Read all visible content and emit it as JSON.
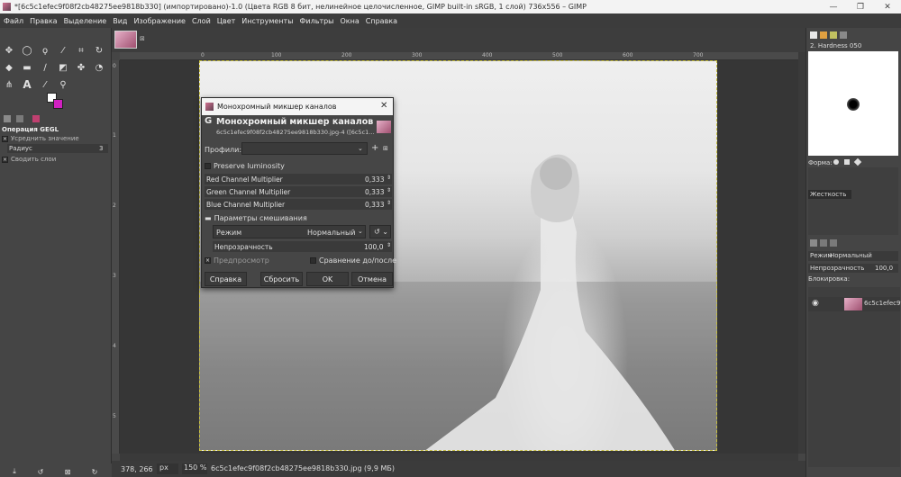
{
  "window": {
    "title": "*[6c5c1efec9f08f2cb48275ee9818b330] (импортировано)-1.0 (Цвета RGB 8 бит, нелинейное целочисленное, GIMP built-in sRGB, 1 слой) 736x556 – GIMP",
    "minimize": "—",
    "maximize": "❐",
    "close": "✕"
  },
  "menu": [
    "Файл",
    "Правка",
    "Выделение",
    "Вид",
    "Изображение",
    "Слой",
    "Цвет",
    "Инструменты",
    "Фильтры",
    "Окна",
    "Справка"
  ],
  "tool_options": {
    "title": "Операция GEGL",
    "sample_average": "Усреднить значение",
    "radius_label": "Радиус",
    "radius_value": "3",
    "sample_merged": "Сводить слои"
  },
  "rulers": {
    "top": [
      "0",
      "100",
      "200",
      "300",
      "400",
      "500",
      "600",
      "700"
    ],
    "left": [
      "0",
      "1",
      "2",
      "3",
      "4",
      "5"
    ]
  },
  "dialog": {
    "window_title": "Монохромный микшер каналов",
    "header_title": "Монохромный микшер каналов",
    "header_subtitle": "6c5c1efec9f08f2cb48275ee9818b330.jpg-4 ([6c5c1...",
    "presets_label": "Профили:",
    "preserve_luminosity": "Preserve luminosity",
    "red_label": "Red Channel Multiplier",
    "red_value": "0,333",
    "green_label": "Green Channel Multiplier",
    "green_value": "0,333",
    "blue_label": "Blue Channel Multiplier",
    "blue_value": "0,333",
    "blending_section": "Параметры смешивания",
    "mode_label": "Режим",
    "mode_value": "Нормальный",
    "opacity_label": "Непрозрачность",
    "opacity_value": "100,0",
    "preview_label": "Предпросмотр",
    "split_view_label": "Сравнение до/после",
    "help_button": "Справка",
    "reset_button": "Сбросить",
    "ok_button": "OK",
    "cancel_button": "Отмена"
  },
  "statusbar": {
    "coords": "378, 266",
    "unit": "px",
    "zoom": "150 %",
    "info": "6c5c1efec9f08f2cb48275ee9818b330.jpg (9,9 МБ)"
  },
  "brushes": {
    "selected": "2. Hardness 050",
    "shape_label": "Форма:",
    "hardness_label": "Жесткость"
  },
  "layers": {
    "mode_label": "Режим",
    "mode_value": "Нормальный",
    "opacity_label": "Непрозрачность",
    "opacity_value": "100,0",
    "lock_label": "Блокировка:",
    "layer_name": "6c5c1efec9f0"
  },
  "colors": {
    "fg": "#ffffff",
    "bg": "#d020c0",
    "accent": "#c8c040"
  }
}
